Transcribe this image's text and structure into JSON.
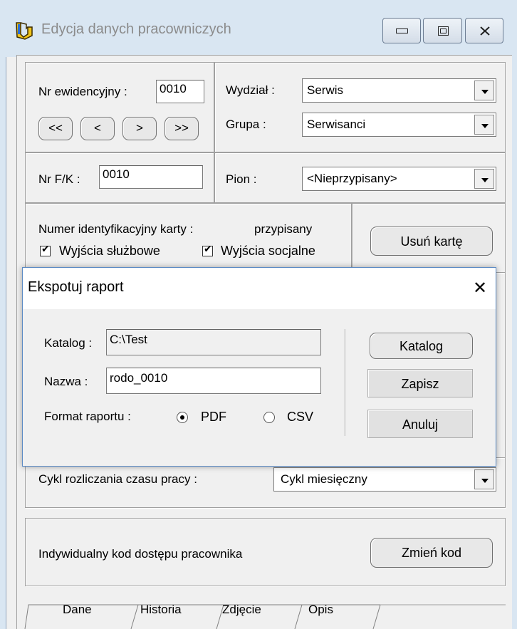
{
  "window": {
    "title": "Edycja danych pracowniczych",
    "accent": "#d9e6f2"
  },
  "employee": {
    "nr_ewid_label": "Nr ewidencyjny :",
    "nr_ewid_value": "0010",
    "nav": [
      "<<",
      "<",
      ">",
      ">>"
    ],
    "wydzial_label": "Wydział :",
    "wydzial_value": "Serwis",
    "grupa_label": "Grupa :",
    "grupa_value": "Serwisanci",
    "nrfk_label": "Nr F/K :",
    "nrfk_value": "0010",
    "pion_label": "Pion :",
    "pion_value": "<Nieprzypisany>",
    "karta_label": "Numer identyfikacyjny karty :",
    "karta_status": "przypisany",
    "wyjscia_sluzbowe": "Wyjścia służbowe",
    "wyjscia_socjalne": "Wyjścia socjalne",
    "usun_karte": "Usuń kartę",
    "cykl_label": "Cykl rozliczania czasu pracy :",
    "cykl_value": "Cykl miesięczny",
    "kod_label": "Indywidualny kod dostępu pracownika",
    "zmien_kod": "Zmień kod"
  },
  "tabs": [
    "Dane",
    "Historia",
    "Zdjęcie",
    "Opis"
  ],
  "dialog": {
    "title": "Ekspotuj raport",
    "katalog_label": "Katalog :",
    "katalog_value": "C:\\Test",
    "nazwa_label": "Nazwa :",
    "nazwa_value": "rodo_0010",
    "format_label": "Format raportu :",
    "format_pdf": "PDF",
    "format_csv": "CSV",
    "selected_format": "PDF",
    "btn_katalog": "Katalog",
    "btn_zapisz": "Zapisz",
    "btn_anuluj": "Anuluj"
  }
}
